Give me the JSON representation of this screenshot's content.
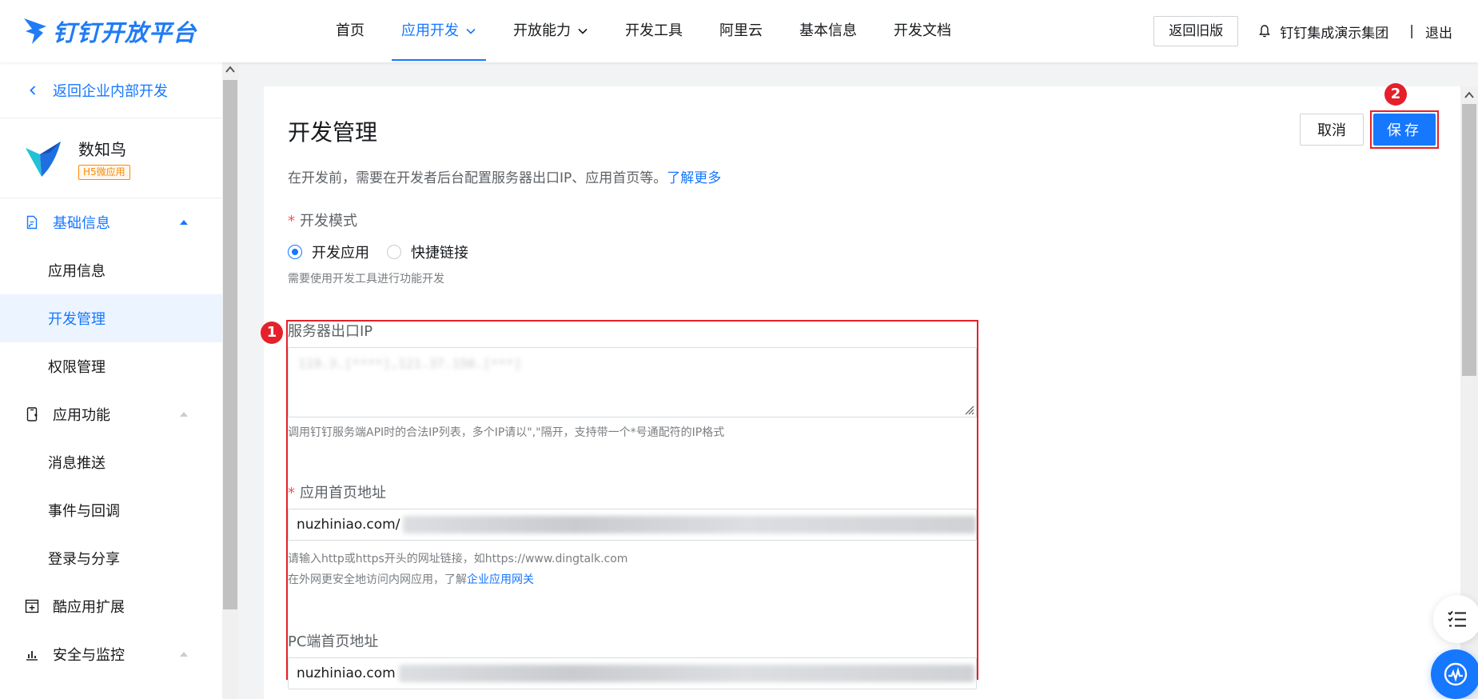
{
  "brand": {
    "name": "钉钉开放平台",
    "color": "#1677ff"
  },
  "nav": {
    "items": [
      {
        "label": "首页",
        "active": false,
        "dropdown": false
      },
      {
        "label": "应用开发",
        "active": true,
        "dropdown": true
      },
      {
        "label": "开放能力",
        "active": false,
        "dropdown": true
      },
      {
        "label": "开发工具",
        "active": false,
        "dropdown": false
      },
      {
        "label": "阿里云",
        "active": false,
        "dropdown": false
      },
      {
        "label": "基本信息",
        "active": false,
        "dropdown": false
      },
      {
        "label": "开发文档",
        "active": false,
        "dropdown": false
      }
    ],
    "old_version_label": "返回旧版",
    "org_name": "钉钉集成演示集团",
    "separator": "|",
    "logout_label": "退出"
  },
  "sidebar": {
    "back_label": "返回企业内部开发",
    "app": {
      "name": "数知鸟",
      "tag": "H5微应用"
    },
    "groups": [
      {
        "label": "基础信息",
        "icon": "doc-icon",
        "open": true,
        "items": [
          {
            "label": "应用信息",
            "active": false
          },
          {
            "label": "开发管理",
            "active": true
          },
          {
            "label": "权限管理",
            "active": false
          }
        ]
      },
      {
        "label": "应用功能",
        "icon": "phone-icon",
        "open": false,
        "items": [
          {
            "label": "消息推送",
            "active": false
          },
          {
            "label": "事件与回调",
            "active": false
          },
          {
            "label": "登录与分享",
            "active": false
          }
        ]
      },
      {
        "label": "酷应用扩展",
        "icon": "plus-box-icon",
        "open": false,
        "items": []
      },
      {
        "label": "安全与监控",
        "icon": "bar-chart-icon",
        "open": false,
        "items": []
      }
    ]
  },
  "page": {
    "title": "开发管理",
    "cancel_label": "取消",
    "save_label": "保存",
    "description": "在开发前，需要在开发者后台配置服务器出口IP、应用首页等。",
    "learn_more": "了解更多",
    "annotation_1": "1",
    "annotation_2": "2",
    "dev_mode": {
      "label": "开发模式",
      "options": [
        {
          "label": "开发应用",
          "selected": true
        },
        {
          "label": "快捷链接",
          "selected": false
        }
      ],
      "hint": "需要使用开发工具进行功能开发"
    },
    "server_ip": {
      "label": "服务器出口IP",
      "value": "119.3.[****],121.37.156.[***]",
      "hint": "调用钉钉服务端API时的合法IP列表，多个IP请以\",\"隔开，支持带一个*号通配符的IP格式"
    },
    "home_url": {
      "label": "应用首页地址",
      "value_visible": "nuzhiniao.com/",
      "hint_1": "请输入http或https开头的网址链接，如https://www.dingtalk.com",
      "hint_2": "在外网更安全地访问内网应用，了解",
      "hint_link": "企业应用网关"
    },
    "pc_url": {
      "label": "PC端首页地址",
      "value_visible": "nuzhiniao.com"
    }
  }
}
